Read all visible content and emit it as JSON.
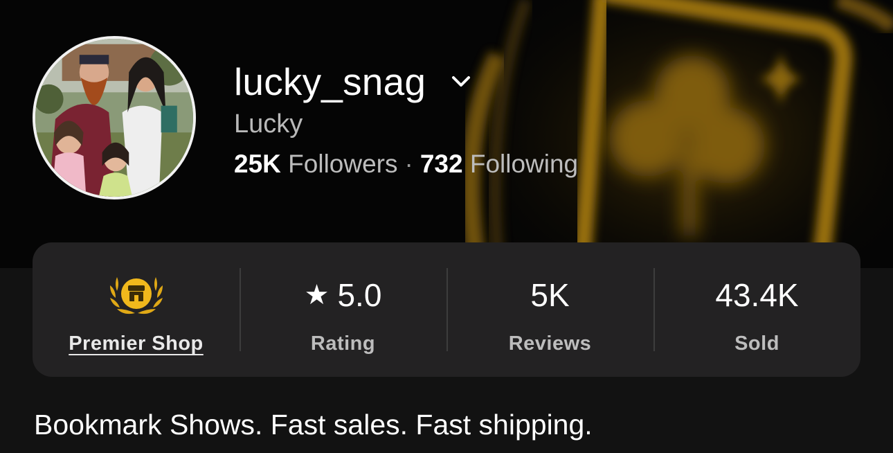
{
  "profile": {
    "username": "lucky_snag",
    "display_name": "Lucky",
    "followers_count": "25K",
    "followers_label": "Followers",
    "separator": "·",
    "following_count": "732",
    "following_label": "Following",
    "bio": "Bookmark Shows. Fast sales. Fast shipping."
  },
  "stats": {
    "premier_label": "Premier Shop",
    "rating_icon": "★",
    "rating_value": "5.0",
    "rating_label": "Rating",
    "reviews_value": "5K",
    "reviews_label": "Reviews",
    "sold_value": "43.4K",
    "sold_label": "Sold"
  },
  "icons": {
    "banner": "clover-card-banner",
    "username_menu": "chevron-down-icon",
    "premier_badge": "premier-shop-badge-icon",
    "rating": "star-icon"
  },
  "colors": {
    "background": "#121212",
    "card": "#232223",
    "gold": "#d8a21a",
    "muted_text": "#bdbdbd"
  }
}
